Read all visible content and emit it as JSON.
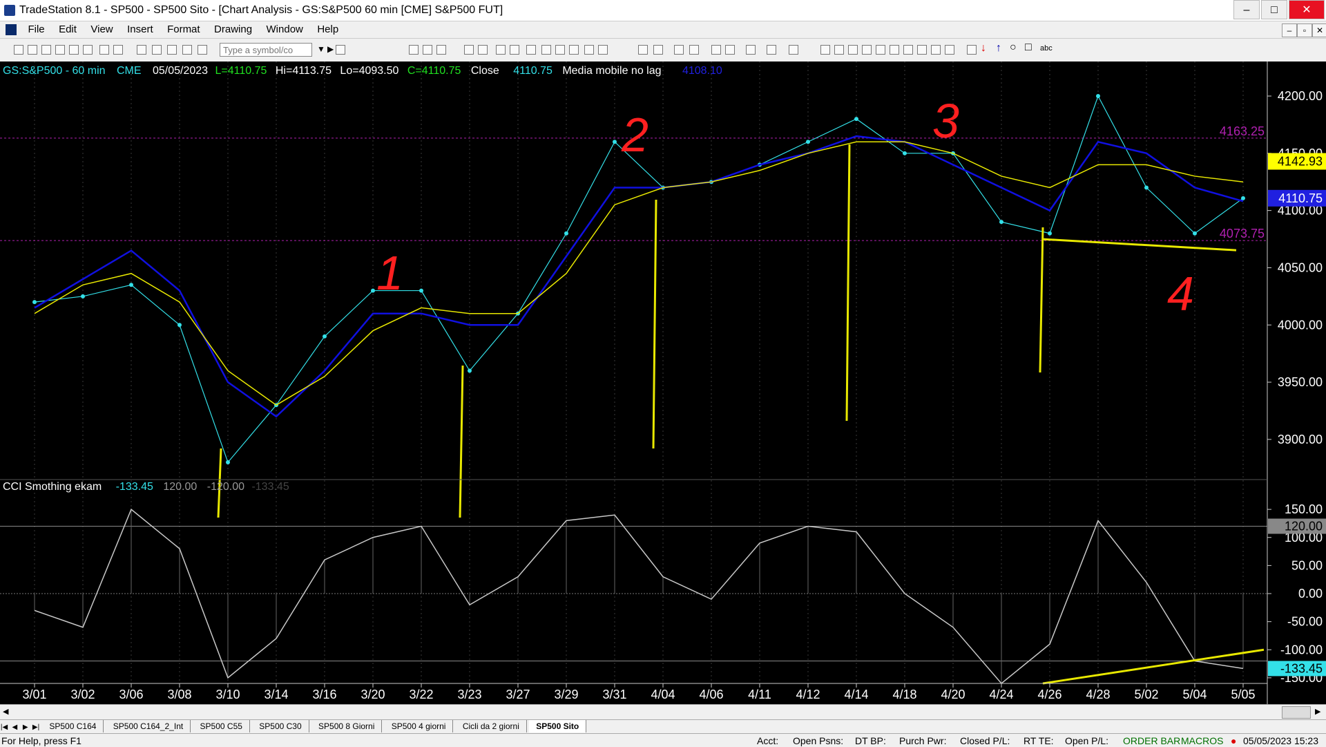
{
  "window": {
    "title": "TradeStation 8.1 - SP500 - SP500 Sito - [Chart Analysis - GS:S&P500  60 min  [CME] S&P500 FUT]",
    "controls": [
      "–",
      "□",
      "✕"
    ]
  },
  "menu": {
    "items": [
      "File",
      "Edit",
      "View",
      "Insert",
      "Format",
      "Drawing",
      "Window",
      "Help"
    ]
  },
  "toolbar": {
    "symbol_placeholder": "Type a symbol/co"
  },
  "header": {
    "symbol": "GS:S&P500 - 60 min",
    "exchange": "CME",
    "date": "05/05/2023",
    "last": "L=4110.75",
    "high": "Hi=4113.75",
    "low": "Lo=4093.50",
    "close": "C=4110.75",
    "close_label": "Close",
    "close_value": "4110.75",
    "indicator_name": "Media mobile no lag",
    "indicator_value": "4108.10"
  },
  "cci_header": {
    "name": "CCI Smothing ekam",
    "value": "-133.45",
    "upper": "120.00",
    "lower": "-120.00",
    "extra": "-133.45"
  },
  "chart_data": [
    {
      "type": "line",
      "title": "",
      "x": [
        "3/01",
        "3/02",
        "3/06",
        "3/08",
        "3/10",
        "3/14",
        "3/16",
        "3/20",
        "3/22",
        "3/23",
        "3/27",
        "3/29",
        "3/31",
        "4/04",
        "4/06",
        "4/11",
        "4/12",
        "4/14",
        "4/18",
        "4/20",
        "4/24",
        "4/26",
        "4/28",
        "5/02",
        "5/04",
        "5/05"
      ],
      "ylim": [
        3880,
        4200
      ],
      "yticks": [
        "4200.00",
        "4150.00",
        "4100.00",
        "4050.00",
        "4000.00",
        "3950.00",
        "3900.00"
      ],
      "series": [
        {
          "values": [
            4020,
            4025,
            4035,
            4000,
            3880,
            3930,
            3990,
            4030,
            4030,
            3960,
            4010,
            4080,
            4160,
            4120,
            4125,
            4140,
            4160,
            4180,
            4150,
            4150,
            4090,
            4080,
            4200,
            4120,
            4080,
            4110.75
          ]
        },
        {
          "values": [
            4015,
            4040,
            4065,
            4030,
            3950,
            3920,
            3960,
            4010,
            4010,
            4000,
            4000,
            4060,
            4120,
            4120,
            4125,
            4140,
            4150,
            4165,
            4160,
            4140,
            4120,
            4100,
            4160,
            4150,
            4120,
            4108.1
          ]
        },
        {
          "values": [
            4010,
            4035,
            4045,
            4020,
            3960,
            3930,
            3955,
            3995,
            4015,
            4010,
            4010,
            4045,
            4105,
            4120,
            4125,
            4135,
            4150,
            4160,
            4160,
            4150,
            4130,
            4120,
            4140,
            4140,
            4130,
            4125
          ]
        }
      ],
      "price_labels": [
        "4163.25",
        "4142.93",
        "4110.75",
        "4073.75"
      ],
      "annotations": [
        "1",
        "2",
        "3",
        "4"
      ]
    },
    {
      "type": "line",
      "title": "",
      "ylim": [
        -160,
        160
      ],
      "yticks": [
        "150.00",
        "100.00",
        "50.00",
        "0.00",
        "-50.00",
        "-100.00",
        "-150.00"
      ],
      "levels": [
        "120.00",
        "-120.00"
      ],
      "current_label": "-133.45",
      "series": [
        {
          "values": [
            -30,
            -60,
            150,
            80,
            -150,
            -80,
            60,
            100,
            120,
            -20,
            30,
            130,
            140,
            30,
            -10,
            90,
            120,
            110,
            0,
            -60,
            -160,
            -90,
            130,
            20,
            -120,
            -133.45
          ]
        }
      ]
    }
  ],
  "tabs": [
    "SP500 C164",
    "SP500 C164_2_Int",
    "SP500 C55",
    "SP500 C30",
    "SP500 8 Giorni",
    "SP500 4 giorni",
    "Cicli da 2 giorni",
    "SP500 Sito"
  ],
  "status": {
    "help": "For Help, press F1",
    "acct": "Acct:",
    "open_psns": "Open Psns:",
    "dt_bp": "DT BP:",
    "purch_pwr": "Purch Pwr:",
    "closed_pl": "Closed P/L:",
    "rt_te": "RT TE:",
    "open_pl": "Open P/L:",
    "order_bar": "ORDER BAR",
    "macros": "MACROS",
    "datetime": "05/05/2023 15:23"
  },
  "colors": {
    "price": "#33e0e8",
    "ma_blue": "#1010e0",
    "ma_yellow": "#e8e800",
    "annotation_red": "#ff2020",
    "level_purple": "#b020b0",
    "cci": "#c8c8c8"
  }
}
